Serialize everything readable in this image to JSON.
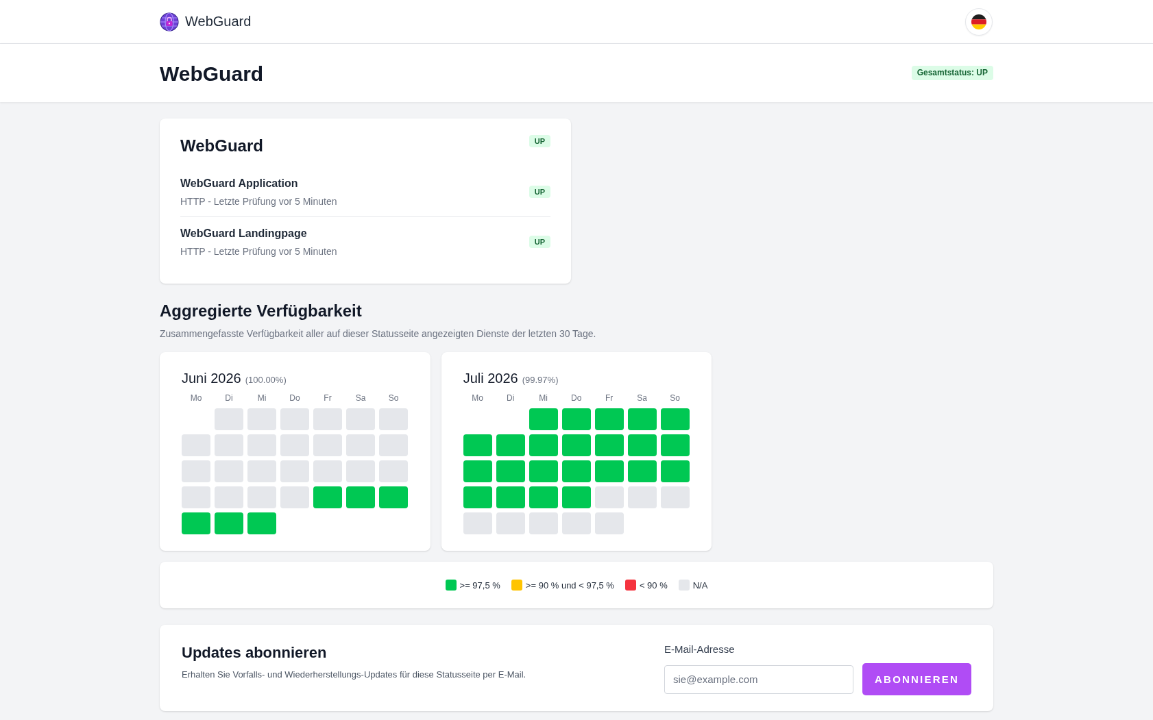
{
  "nav": {
    "brand": "WebGuard"
  },
  "header": {
    "title": "WebGuard",
    "overall_status": "Gesamtstatus: UP"
  },
  "service_group": {
    "title": "WebGuard",
    "status": "UP",
    "services": [
      {
        "name": "WebGuard Application",
        "detail": "HTTP - Letzte Prüfung vor 5 Minuten",
        "status": "UP"
      },
      {
        "name": "WebGuard Landingpage",
        "detail": "HTTP - Letzte Prüfung vor 5 Minuten",
        "status": "UP"
      }
    ]
  },
  "availability": {
    "title": "Aggregierte Verfügbarkeit",
    "description": "Zusammengefasste Verfügbarkeit aller auf dieser Statusseite angezeigten Dienste der letzten 30 Tage.",
    "months": [
      {
        "name": "Juni 2026",
        "percentage": "(100.00%)",
        "weekdays": [
          "Mo",
          "Di",
          "Mi",
          "Do",
          "Fr",
          "Sa",
          "So"
        ],
        "weeks": [
          [
            {
              "kind": "blank"
            },
            {
              "kind": "day",
              "color": "#e5e7eb"
            },
            {
              "kind": "day",
              "color": "#e5e7eb"
            },
            {
              "kind": "day",
              "color": "#e5e7eb"
            },
            {
              "kind": "day",
              "color": "#e5e7eb"
            },
            {
              "kind": "day",
              "color": "#e5e7eb"
            },
            {
              "kind": "day",
              "color": "#e5e7eb"
            }
          ],
          [
            {
              "kind": "day",
              "color": "#e5e7eb"
            },
            {
              "kind": "day",
              "color": "#e5e7eb"
            },
            {
              "kind": "day",
              "color": "#e5e7eb"
            },
            {
              "kind": "day",
              "color": "#e5e7eb"
            },
            {
              "kind": "day",
              "color": "#e5e7eb"
            },
            {
              "kind": "day",
              "color": "#e5e7eb"
            },
            {
              "kind": "day",
              "color": "#e5e7eb"
            }
          ],
          [
            {
              "kind": "day",
              "color": "#e5e7eb"
            },
            {
              "kind": "day",
              "color": "#e5e7eb"
            },
            {
              "kind": "day",
              "color": "#e5e7eb"
            },
            {
              "kind": "day",
              "color": "#e5e7eb"
            },
            {
              "kind": "day",
              "color": "#e5e7eb"
            },
            {
              "kind": "day",
              "color": "#e5e7eb"
            },
            {
              "kind": "day",
              "color": "#e5e7eb"
            }
          ],
          [
            {
              "kind": "day",
              "color": "#e5e7eb"
            },
            {
              "kind": "day",
              "color": "#e5e7eb"
            },
            {
              "kind": "day",
              "color": "#e5e7eb"
            },
            {
              "kind": "day",
              "color": "#e5e7eb"
            },
            {
              "kind": "day",
              "color": "#00c853"
            },
            {
              "kind": "day",
              "color": "#00c853"
            },
            {
              "kind": "day",
              "color": "#00c853"
            }
          ],
          [
            {
              "kind": "day",
              "color": "#00c853"
            },
            {
              "kind": "day",
              "color": "#00c853"
            },
            {
              "kind": "day",
              "color": "#00c853"
            }
          ]
        ]
      },
      {
        "name": "Juli 2026",
        "percentage": "(99.97%)",
        "weekdays": [
          "Mo",
          "Di",
          "Mi",
          "Do",
          "Fr",
          "Sa",
          "So"
        ],
        "weeks": [
          [
            {
              "kind": "blank"
            },
            {
              "kind": "blank"
            },
            {
              "kind": "day",
              "color": "#00c853"
            },
            {
              "kind": "day",
              "color": "#00c853"
            },
            {
              "kind": "day",
              "color": "#00c853"
            },
            {
              "kind": "day",
              "color": "#00c853"
            },
            {
              "kind": "day",
              "color": "#00c853"
            }
          ],
          [
            {
              "kind": "day",
              "color": "#00c853"
            },
            {
              "kind": "day",
              "color": "#00c853"
            },
            {
              "kind": "day",
              "color": "#00c853"
            },
            {
              "kind": "day",
              "color": "#00c853"
            },
            {
              "kind": "day",
              "color": "#00c853"
            },
            {
              "kind": "day",
              "color": "#00c853"
            },
            {
              "kind": "day",
              "color": "#00c853"
            }
          ],
          [
            {
              "kind": "day",
              "color": "#00c853"
            },
            {
              "kind": "day",
              "color": "#00c853"
            },
            {
              "kind": "day",
              "color": "#00c853"
            },
            {
              "kind": "day",
              "color": "#00c853"
            },
            {
              "kind": "day",
              "color": "#00c853"
            },
            {
              "kind": "day",
              "color": "#00c853"
            },
            {
              "kind": "day",
              "color": "#00c853"
            }
          ],
          [
            {
              "kind": "day",
              "color": "#00c853"
            },
            {
              "kind": "day",
              "color": "#00c853"
            },
            {
              "kind": "day",
              "color": "#00c853"
            },
            {
              "kind": "day",
              "color": "#00c853"
            },
            {
              "kind": "day",
              "color": "#e5e7eb"
            },
            {
              "kind": "day",
              "color": "#e5e7eb"
            },
            {
              "kind": "day",
              "color": "#e5e7eb"
            }
          ],
          [
            {
              "kind": "day",
              "color": "#e5e7eb"
            },
            {
              "kind": "day",
              "color": "#e5e7eb"
            },
            {
              "kind": "day",
              "color": "#e5e7eb"
            },
            {
              "kind": "day",
              "color": "#e5e7eb"
            },
            {
              "kind": "day",
              "color": "#e5e7eb"
            }
          ]
        ]
      }
    ],
    "legend": [
      {
        "label": ">= 97,5 %",
        "color": "#00c853"
      },
      {
        "label": ">= 90 % und < 97,5 %",
        "color": "#ffc400"
      },
      {
        "label": "< 90 %",
        "color": "#f5333f"
      },
      {
        "label": "N/A",
        "color": "#e5e7eb"
      }
    ]
  },
  "subscribe": {
    "title": "Updates abonnieren",
    "description": "Erhalten Sie Vorfalls- und Wiederherstellungs-Updates für diese Statusseite per E-Mail.",
    "email_field": {
      "label": "E-Mail-Adresse",
      "placeholder": "sie@example.com"
    },
    "button": "ABONNIEREN"
  }
}
